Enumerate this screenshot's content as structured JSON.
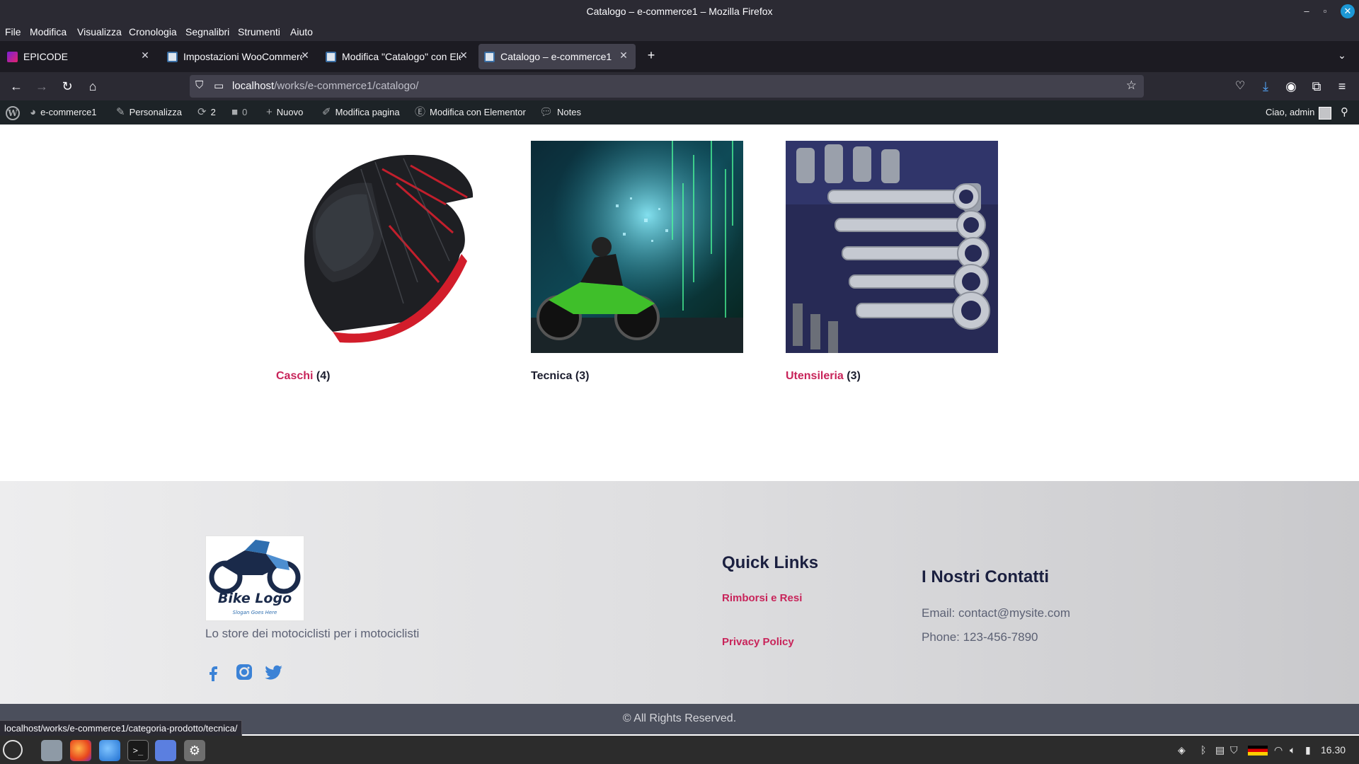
{
  "window": {
    "title": "Catalogo – e-commerce1 – Mozilla Firefox"
  },
  "menu": [
    "File",
    "Modifica",
    "Visualizza",
    "Cronologia",
    "Segnalibri",
    "Strumenti",
    "Aiuto"
  ],
  "tabs": [
    {
      "label": "EPICODE",
      "favicon": "epicode-icon"
    },
    {
      "label": "Impostazioni WooCommerc",
      "favicon": "wordpress-icon"
    },
    {
      "label": "Modifica \"Catalogo\" con Ele",
      "favicon": "wordpress-icon"
    },
    {
      "label": "Catalogo – e-commerce1",
      "favicon": "wordpress-icon",
      "active": true
    }
  ],
  "url": {
    "host": "localhost",
    "path": "/works/e-commerce1/catalogo/"
  },
  "adminbar": {
    "site": "e-commerce1",
    "customize": "Personalizza",
    "updates": "2",
    "comments": "0",
    "new": "Nuovo",
    "edit_page": "Modifica pagina",
    "elementor": "Modifica con Elementor",
    "notes": "Notes",
    "greeting": "Ciao, admin"
  },
  "categories": [
    {
      "name": "Caschi",
      "count": "(4)",
      "image": "motorcycle-helmet"
    },
    {
      "name": "Tecnica",
      "count": "(3)",
      "image": "motorcycle-digital"
    },
    {
      "name": "Utensileria",
      "count": "(3)",
      "image": "wrench-set"
    }
  ],
  "footer": {
    "logo_title": "Bike Logo",
    "logo_slogan": "Slogan Goes Here",
    "tagline": "Lo store dei motociclisti per i motociclisti",
    "quick_links_title": "Quick Links",
    "links": [
      "Rimborsi e Resi",
      "Privacy Policy"
    ],
    "contacts_title": "I Nostri Contatti",
    "email": "Email: contact@mysite.com",
    "phone": "Phone: 123-456-7890",
    "copyright": "© All Rights Reserved."
  },
  "status_url": "localhost/works/e-commerce1/categoria-prodotto/tecnica/",
  "taskbar": {
    "clock": "16.30"
  },
  "colors": {
    "accent_link": "#c8245a",
    "heading": "#1b2040",
    "browser_chrome": "#2b2a33"
  }
}
